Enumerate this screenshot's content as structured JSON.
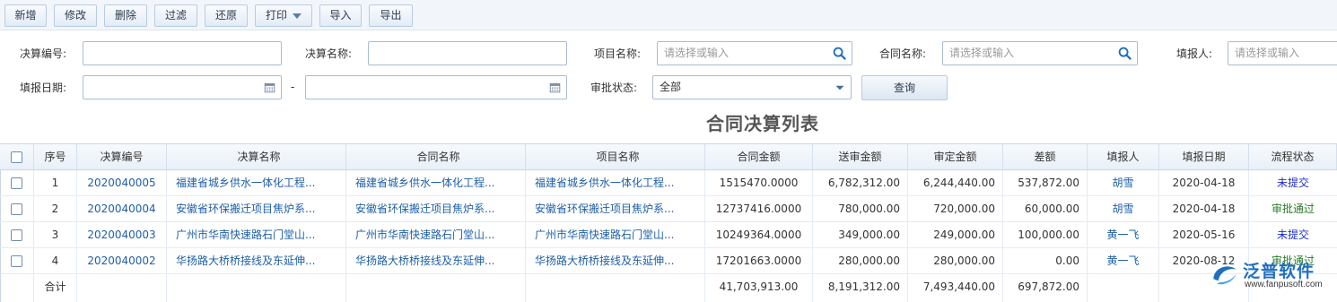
{
  "toolbar": {
    "buttons": [
      "新增",
      "修改",
      "删除",
      "过滤",
      "还原",
      "打印",
      "导入",
      "导出"
    ]
  },
  "filters": {
    "code_label": "决算编号:",
    "name_label": "决算名称:",
    "project_label": "项目名称:",
    "project_placeholder": "请选择或输入",
    "contract_label": "合同名称:",
    "contract_placeholder": "请选择或输入",
    "reporter_label": "填报人:",
    "reporter_placeholder": "请选择或输入",
    "date_label": "填报日期:",
    "date_separator": "-",
    "status_label": "审批状态:",
    "status_value": "全部",
    "query_button": "查询"
  },
  "table": {
    "title": "合同决算列表",
    "headers": [
      "序号",
      "决算编号",
      "决算名称",
      "合同名称",
      "项目名称",
      "合同金额",
      "送审金额",
      "审定金额",
      "差额",
      "填报人",
      "填报日期",
      "流程状态"
    ],
    "rows": [
      {
        "no": "1",
        "code": "2020040005",
        "jname": "福建省城乡供水一体化工程...",
        "hname": "福建省城乡供水一体化工程...",
        "pname": "福建省城乡供水一体化工程...",
        "amount": "1515470.0000",
        "send": "6,782,312.00",
        "approved": "6,244,440.00",
        "diff": "537,872.00",
        "user": "胡雪",
        "date": "2020-04-18",
        "status": "未提交"
      },
      {
        "no": "2",
        "code": "2020040004",
        "jname": "安徽省环保搬迁项目焦炉系...",
        "hname": "安徽省环保搬迁项目焦炉系...",
        "pname": "安徽省环保搬迁项目焦炉系...",
        "amount": "12737416.0000",
        "send": "780,000.00",
        "approved": "720,000.00",
        "diff": "60,000.00",
        "user": "胡雪",
        "date": "2020-04-18",
        "status": "审批通过"
      },
      {
        "no": "3",
        "code": "2020040003",
        "jname": "广州市华南快速路石门堂山...",
        "hname": "广州市华南快速路石门堂山...",
        "pname": "广州市华南快速路石门堂山...",
        "amount": "10249364.0000",
        "send": "349,000.00",
        "approved": "249,000.00",
        "diff": "100,000.00",
        "user": "黄一飞",
        "date": "2020-05-16",
        "status": "未提交"
      },
      {
        "no": "4",
        "code": "2020040002",
        "jname": "华扬路大桥桥接线及东延伸...",
        "hname": "华扬路大桥桥接线及东延伸...",
        "pname": "华扬路大桥桥接线及东延伸...",
        "amount": "17201663.0000",
        "send": "280,000.00",
        "approved": "280,000.00",
        "diff": "0.00",
        "user": "黄一飞",
        "date": "2020-08-12",
        "status": "审批通过"
      }
    ],
    "total": {
      "label": "合计",
      "amount": "41,703,913.00",
      "send": "8,191,312.00",
      "approved": "7,493,440.00",
      "diff": "697,872.00"
    }
  },
  "watermark": {
    "brand": "泛普软件",
    "url": "www.fanpusoft.com"
  },
  "colors": {
    "link": "#1f5fa8",
    "status_pending": "#1c2fc9",
    "status_approved": "#2c7a2c"
  }
}
